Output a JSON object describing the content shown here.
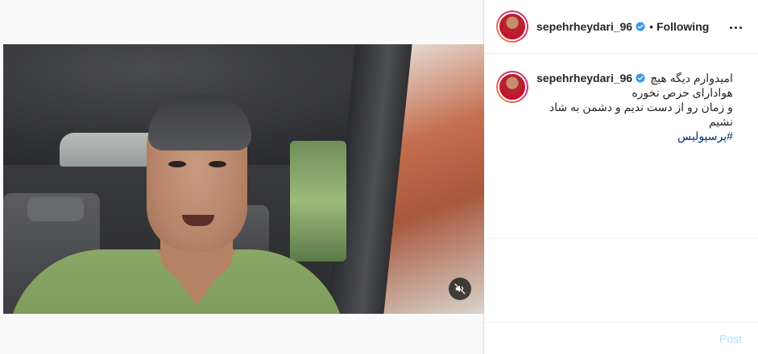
{
  "header": {
    "username": "sepehrheydari_96",
    "separator": "•",
    "follow_status": "Following"
  },
  "caption": {
    "username": "sepehrheydari_96",
    "line1": "امیدوارم دیگه هیچ",
    "line2": "هوادارای حرص نخوره",
    "line3": "و زمان رو از دست ندیم و دشمن به شاد",
    "line4": "نشیم",
    "hashtag": "#پرسپولیس"
  },
  "comment_box": {
    "placeholder": "",
    "post_label": "Post"
  },
  "colors": {
    "verified_blue": "#3897f0",
    "hashtag": "#00376b",
    "post_disabled": "#b2dffc"
  },
  "icons": {
    "mute": "speaker-muted-icon",
    "verified": "verified-badge-icon",
    "more": "more-options-icon"
  }
}
